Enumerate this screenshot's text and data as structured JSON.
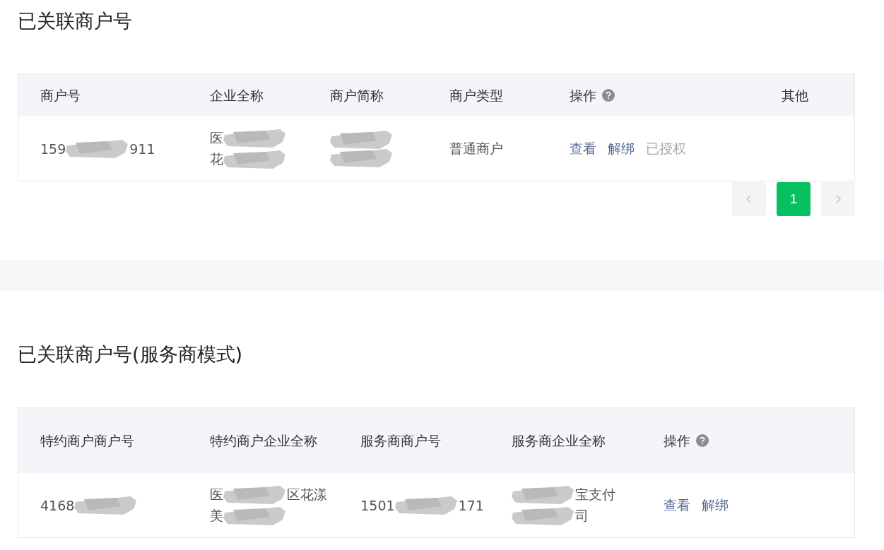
{
  "sections": [
    {
      "title": "已关联商户号",
      "table": {
        "columns": [
          {
            "label": "商户号"
          },
          {
            "label": "企业全称"
          },
          {
            "label": "商户简称"
          },
          {
            "label": "商户类型"
          },
          {
            "label": "操作",
            "help": true
          },
          {
            "label": "其他"
          }
        ],
        "rows": [
          {
            "cells": [
              {
                "kind": "text",
                "lines": [
                  [
                    {
                      "kind": "text",
                      "text": "159"
                    },
                    {
                      "kind": "redaction"
                    },
                    {
                      "kind": "text",
                      "text": "911"
                    }
                  ]
                ]
              },
              {
                "kind": "text",
                "lines": [
                  [
                    {
                      "kind": "text",
                      "text": "医"
                    },
                    {
                      "kind": "redaction"
                    }
                  ],
                  [
                    {
                      "kind": "text",
                      "text": "花"
                    },
                    {
                      "kind": "redaction"
                    }
                  ]
                ]
              },
              {
                "kind": "text",
                "lines": [
                  [
                    {
                      "kind": "redaction"
                    }
                  ],
                  [
                    {
                      "kind": "redaction"
                    }
                  ]
                ]
              },
              {
                "kind": "text",
                "lines": [
                  [
                    {
                      "kind": "text",
                      "text": "普通商户"
                    }
                  ]
                ]
              },
              {
                "kind": "actions",
                "actions": [
                  {
                    "label": "查看",
                    "disabled": false
                  },
                  {
                    "label": "解绑",
                    "disabled": false
                  },
                  {
                    "label": "已授权",
                    "disabled": true
                  }
                ]
              },
              {
                "kind": "empty"
              }
            ]
          }
        ]
      },
      "pagination": {
        "pages": [
          {
            "label": "1",
            "selected": true
          }
        ]
      }
    },
    {
      "title": "已关联商户号(服务商模式)",
      "table": {
        "columns": [
          {
            "label": "特约商户商户号"
          },
          {
            "label": "特约商户企业全称"
          },
          {
            "label": "服务商商户号"
          },
          {
            "label": "服务商企业全称"
          },
          {
            "label": "操作",
            "help": true
          }
        ],
        "rows": [
          {
            "cells": [
              {
                "kind": "text",
                "lines": [
                  [
                    {
                      "kind": "text",
                      "text": "4168"
                    },
                    {
                      "kind": "redaction"
                    }
                  ]
                ]
              },
              {
                "kind": "text",
                "lines": [
                  [
                    {
                      "kind": "text",
                      "text": "医"
                    },
                    {
                      "kind": "redaction"
                    },
                    {
                      "kind": "text",
                      "text": "区花漾"
                    }
                  ],
                  [
                    {
                      "kind": "text",
                      "text": "美"
                    },
                    {
                      "kind": "redaction"
                    }
                  ]
                ]
              },
              {
                "kind": "text",
                "lines": [
                  [
                    {
                      "kind": "text",
                      "text": "1501"
                    },
                    {
                      "kind": "redaction"
                    },
                    {
                      "kind": "text",
                      "text": "171"
                    }
                  ]
                ]
              },
              {
                "kind": "text",
                "lines": [
                  [
                    {
                      "kind": "redaction"
                    },
                    {
                      "kind": "text",
                      "text": "宝支付"
                    }
                  ],
                  [
                    {
                      "kind": "redaction"
                    },
                    {
                      "kind": "text",
                      "text": "司"
                    }
                  ]
                ]
              },
              {
                "kind": "actions",
                "actions": [
                  {
                    "label": "查看",
                    "disabled": false
                  },
                  {
                    "label": "解绑",
                    "disabled": false
                  }
                ]
              }
            ]
          }
        ]
      }
    }
  ]
}
